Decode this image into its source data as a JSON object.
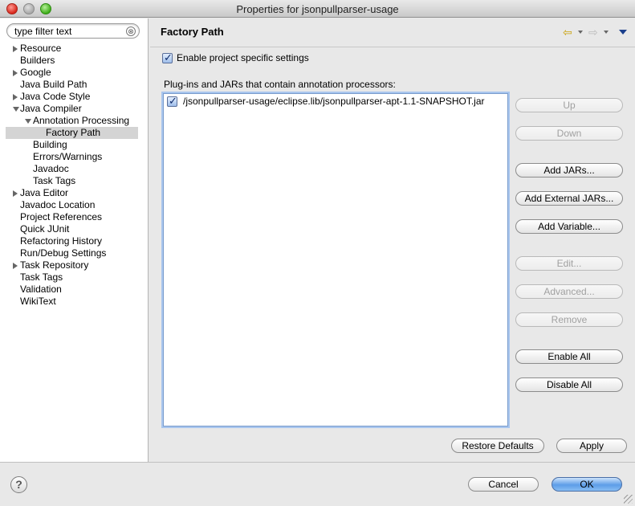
{
  "window": {
    "title": "Properties for jsonpullparser-usage"
  },
  "filter": {
    "value": "type filter text",
    "clear_glyph": "⊗"
  },
  "tree": {
    "items": [
      {
        "label": "Resource",
        "level": 0,
        "expander": "collapsed"
      },
      {
        "label": "Builders",
        "level": 0,
        "expander": "none"
      },
      {
        "label": "Google",
        "level": 0,
        "expander": "collapsed"
      },
      {
        "label": "Java Build Path",
        "level": 0,
        "expander": "none"
      },
      {
        "label": "Java Code Style",
        "level": 0,
        "expander": "collapsed"
      },
      {
        "label": "Java Compiler",
        "level": 0,
        "expander": "expanded"
      },
      {
        "label": "Annotation Processing",
        "level": 1,
        "expander": "expanded"
      },
      {
        "label": "Factory Path",
        "level": 2,
        "expander": "none",
        "selected": true
      },
      {
        "label": "Building",
        "level": 1,
        "expander": "none"
      },
      {
        "label": "Errors/Warnings",
        "level": 1,
        "expander": "none"
      },
      {
        "label": "Javadoc",
        "level": 1,
        "expander": "none"
      },
      {
        "label": "Task Tags",
        "level": 1,
        "expander": "none"
      },
      {
        "label": "Java Editor",
        "level": 0,
        "expander": "collapsed"
      },
      {
        "label": "Javadoc Location",
        "level": 0,
        "expander": "none"
      },
      {
        "label": "Project References",
        "level": 0,
        "expander": "none"
      },
      {
        "label": "Quick JUnit",
        "level": 0,
        "expander": "none"
      },
      {
        "label": "Refactoring History",
        "level": 0,
        "expander": "none"
      },
      {
        "label": "Run/Debug Settings",
        "level": 0,
        "expander": "none"
      },
      {
        "label": "Task Repository",
        "level": 0,
        "expander": "collapsed"
      },
      {
        "label": "Task Tags",
        "level": 0,
        "expander": "none"
      },
      {
        "label": "Validation",
        "level": 0,
        "expander": "none"
      },
      {
        "label": "WikiText",
        "level": 0,
        "expander": "none"
      }
    ]
  },
  "page": {
    "title": "Factory Path",
    "enable_label": "Enable project specific settings",
    "enable_checked": true,
    "list_label": "Plug-ins and JARs that contain annotation processors:",
    "list_items": [
      {
        "label": "/jsonpullparser-usage/eclipse.lib/jsonpullparser-apt-1.1-SNAPSHOT.jar",
        "checked": true
      }
    ]
  },
  "side_buttons": {
    "up": "Up",
    "down": "Down",
    "add_jars": "Add JARs...",
    "add_external_jars": "Add External JARs...",
    "add_variable": "Add Variable...",
    "edit": "Edit...",
    "advanced": "Advanced...",
    "remove": "Remove",
    "enable_all": "Enable All",
    "disable_all": "Disable All"
  },
  "footer": {
    "restore_defaults": "Restore Defaults",
    "apply": "Apply",
    "cancel": "Cancel",
    "ok": "OK",
    "help_glyph": "?"
  },
  "icons": {
    "back": "back-arrow-icon",
    "forward": "forward-arrow-icon",
    "menu": "view-menu-icon",
    "help": "help-icon",
    "checkbox_tick": "✓"
  },
  "colors": {
    "selection": "#d4d4d4",
    "default_button": "#5d9de8",
    "back_arrow": "#c9a20c"
  }
}
